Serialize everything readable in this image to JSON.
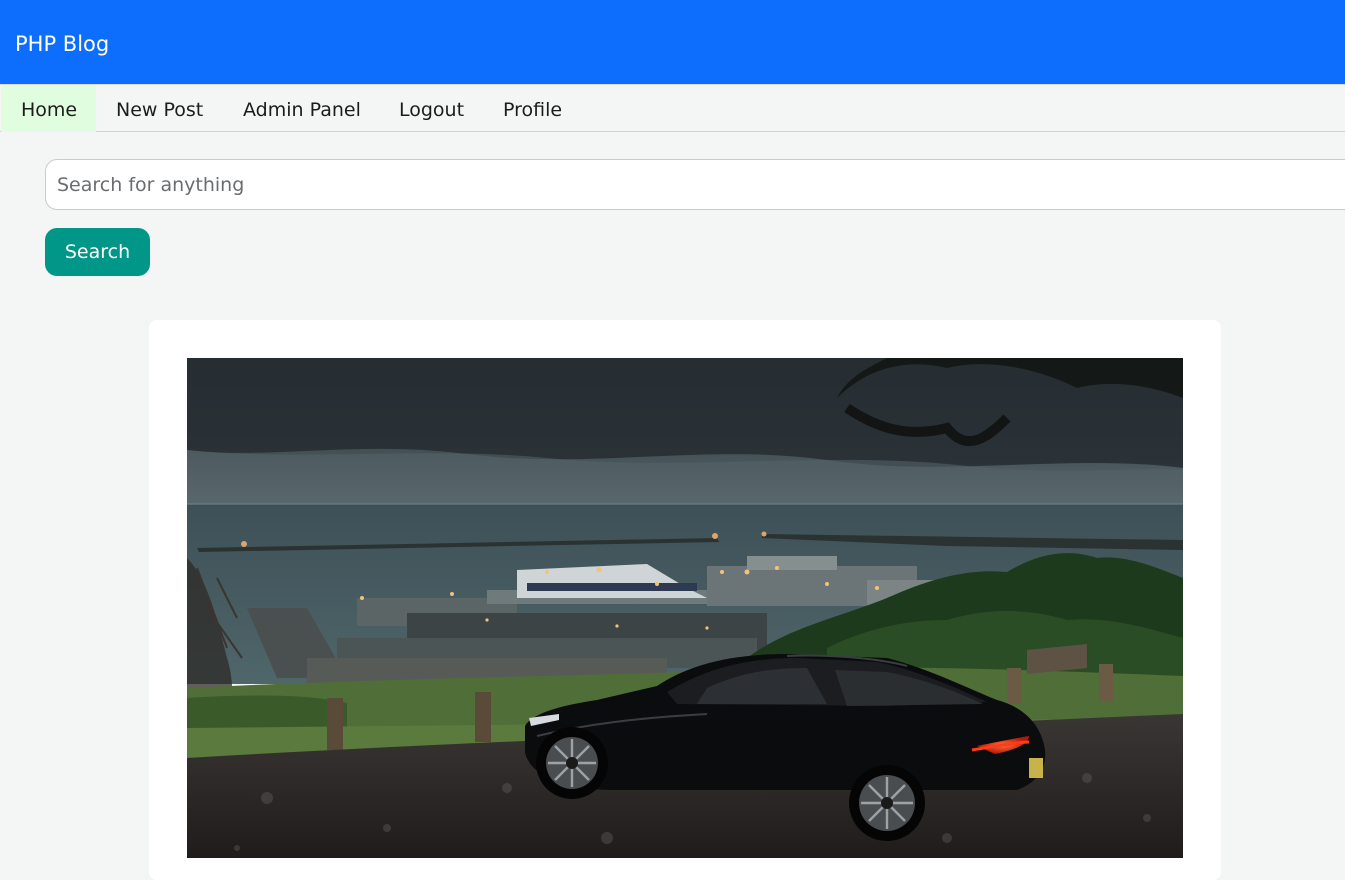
{
  "header": {
    "brand": "PHP Blog",
    "color": "#0d6efd"
  },
  "nav": {
    "items": [
      {
        "label": "Home",
        "active": true
      },
      {
        "label": "New Post",
        "active": false
      },
      {
        "label": "Admin Panel",
        "active": false
      },
      {
        "label": "Logout",
        "active": false
      },
      {
        "label": "Profile",
        "active": false
      }
    ],
    "active_color": "#e1fde0"
  },
  "search": {
    "placeholder": "Search for anything",
    "value": "",
    "button_label": "Search",
    "button_color": "#009688"
  },
  "post": {
    "image": "photo of a black sports car parked on a hill overlooking a harbor with a ferry under stormy sky"
  }
}
